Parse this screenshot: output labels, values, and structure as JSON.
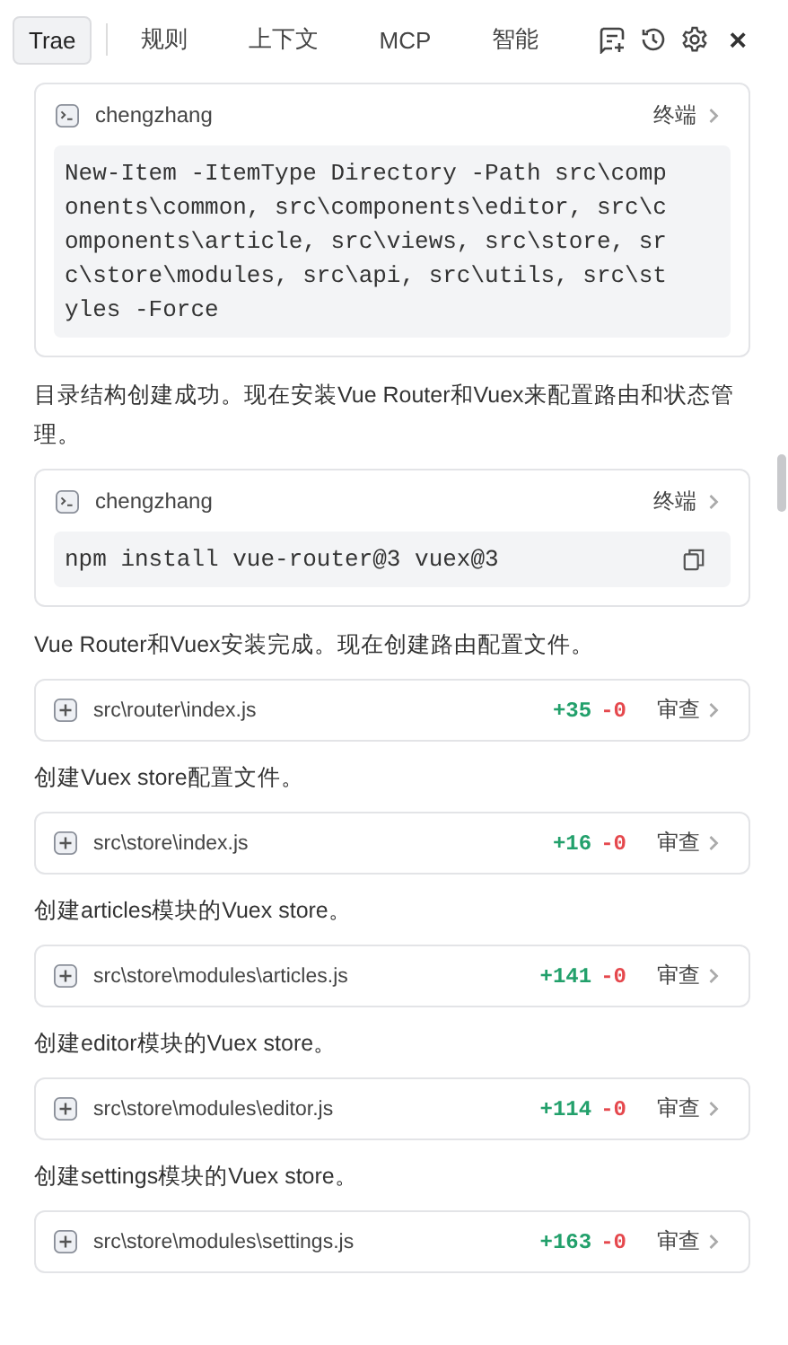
{
  "tabs": [
    {
      "label": "Trae",
      "selected": true
    },
    {
      "label": "规则",
      "selected": false
    },
    {
      "label": "上下文",
      "selected": false
    },
    {
      "label": "MCP",
      "selected": false
    },
    {
      "label": "智能",
      "selected": false
    }
  ],
  "close": "×",
  "messages": [
    {
      "kind": "command",
      "user": "chengzhang",
      "action": "终端",
      "code": "New-Item -ItemType Directory -Path src\\components\\common, src\\components\\editor, src\\components\\article, src\\views, src\\store, src\\store\\modules, src\\api, src\\utils, src\\styles -Force",
      "copy": false
    },
    {
      "kind": "text",
      "text": "目录结构创建成功。现在安装Vue Router和Vuex来配置路由和状态管理。"
    },
    {
      "kind": "command",
      "user": "chengzhang",
      "action": "终端",
      "code": "npm install vue-router@3 vuex@3",
      "copy": true
    },
    {
      "kind": "text",
      "text": "Vue Router和Vuex安装完成。现在创建路由配置文件。"
    },
    {
      "kind": "file",
      "path": "src\\router\\index.js",
      "added": "+35",
      "removed": "-0",
      "action": "审查"
    },
    {
      "kind": "text",
      "text": "创建Vuex store配置文件。"
    },
    {
      "kind": "file",
      "path": "src\\store\\index.js",
      "added": "+16",
      "removed": "-0",
      "action": "审查"
    },
    {
      "kind": "text",
      "text": "创建articles模块的Vuex store。"
    },
    {
      "kind": "file",
      "path": "src\\store\\modules\\articles.js",
      "added": "+141",
      "removed": "-0",
      "action": "审查"
    },
    {
      "kind": "text",
      "text": "创建editor模块的Vuex store。"
    },
    {
      "kind": "file",
      "path": "src\\store\\modules\\editor.js",
      "added": "+114",
      "removed": "-0",
      "action": "审查"
    },
    {
      "kind": "text",
      "text": "创建settings模块的Vuex store。"
    },
    {
      "kind": "file",
      "path": "src\\store\\modules\\settings.js",
      "added": "+163",
      "removed": "-0",
      "action": "审查"
    }
  ]
}
